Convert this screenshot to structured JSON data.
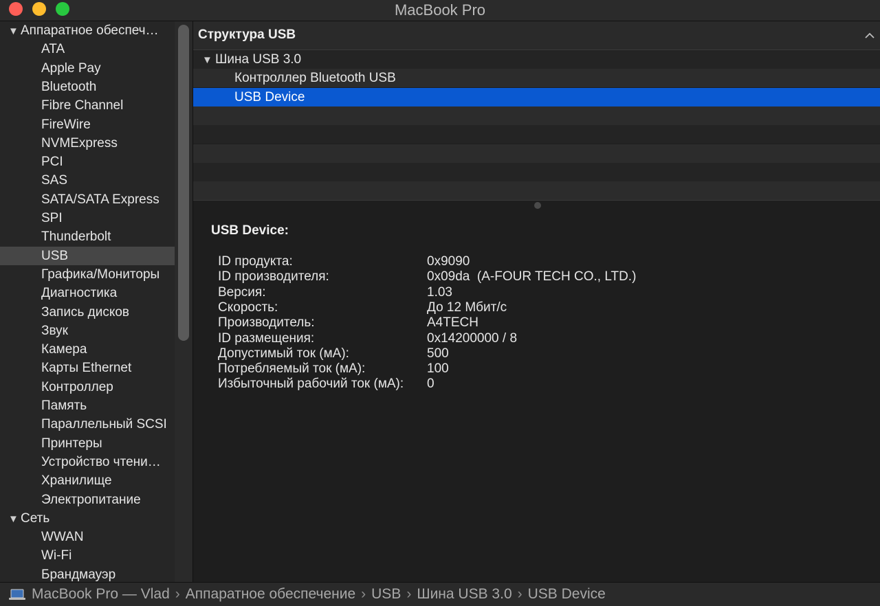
{
  "window": {
    "title": "MacBook Pro"
  },
  "sidebar": {
    "groups": [
      {
        "label": "Аппаратное обеспеч…",
        "items": [
          "ATA",
          "Apple Pay",
          "Bluetooth",
          "Fibre Channel",
          "FireWire",
          "NVMExpress",
          "PCI",
          "SAS",
          "SATA/SATA Express",
          "SPI",
          "Thunderbolt",
          "USB",
          "Графика/Мониторы",
          "Диагностика",
          "Запись дисков",
          "Звук",
          "Камера",
          "Карты Ethernet",
          "Контроллер",
          "Память",
          "Параллельный SCSI",
          "Принтеры",
          "Устройство чтени…",
          "Хранилище",
          "Электропитание"
        ]
      },
      {
        "label": "Сеть",
        "items": [
          "WWAN",
          "Wi-Fi",
          "Брандмауэр"
        ]
      }
    ],
    "selected": "USB"
  },
  "pane": {
    "header": "Структура USB",
    "tree": [
      {
        "label": "Шина USB 3.0",
        "level": 0
      },
      {
        "label": "Контроллер Bluetooth USB",
        "level": 1
      },
      {
        "label": "USB Device",
        "level": 1,
        "selected": true
      }
    ]
  },
  "detail": {
    "title": "USB Device:",
    "props": [
      {
        "label": "ID продукта:",
        "value": "0x9090"
      },
      {
        "label": "ID производителя:",
        "value": "0x09da  (A-FOUR TECH CO., LTD.)"
      },
      {
        "label": "Версия:",
        "value": "1.03"
      },
      {
        "label": "Скорость:",
        "value": "До 12 Мбит/с"
      },
      {
        "label": "Производитель:",
        "value": "A4TECH"
      },
      {
        "label": "ID размещения:",
        "value": "0x14200000 / 8"
      },
      {
        "label": "Допустимый ток (мА):",
        "value": "500"
      },
      {
        "label": "Потребляемый ток (мА):",
        "value": "100"
      },
      {
        "label": "Избыточный рабочий ток (мА):",
        "value": "0"
      }
    ]
  },
  "pathbar": {
    "icon": "macbook-icon",
    "crumbs": [
      "MacBook Pro — Vlad",
      "Аппаратное обеспечение",
      "USB",
      "Шина USB 3.0",
      "USB Device"
    ]
  },
  "colors": {
    "selection": "#0a59d1",
    "sidebar_selected": "#464646"
  }
}
